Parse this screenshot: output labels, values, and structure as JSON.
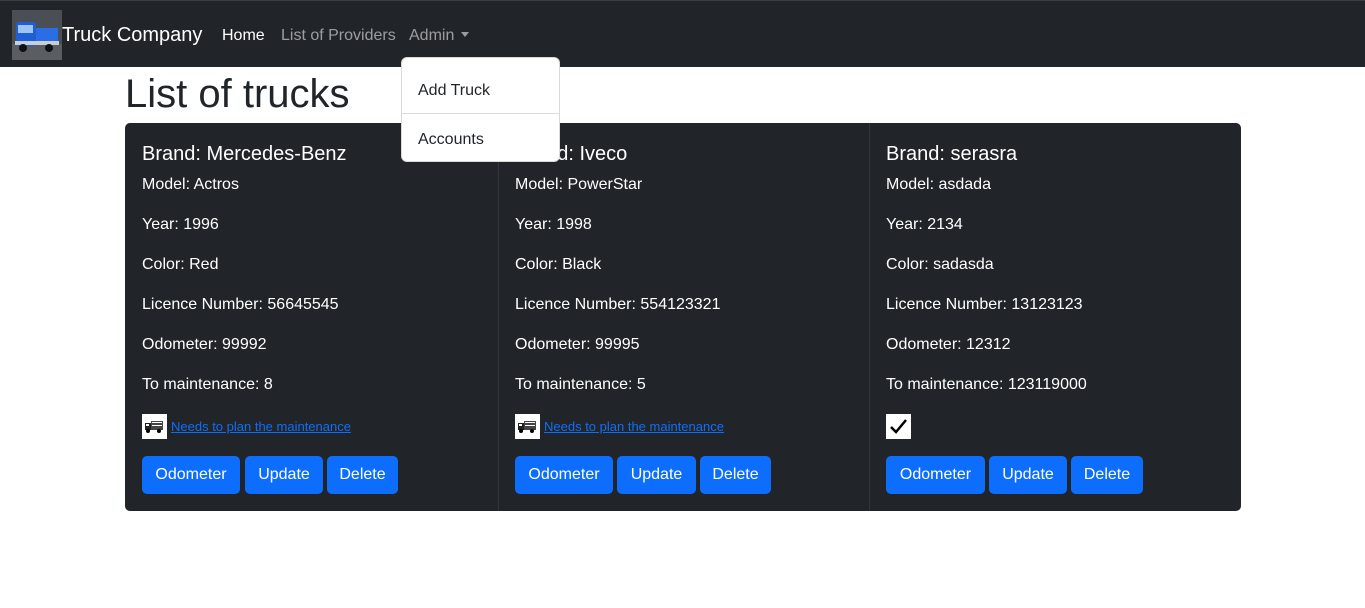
{
  "navbar": {
    "brand": "Truck Company",
    "links": [
      {
        "label": "Home",
        "active": true
      },
      {
        "label": "List of Providers",
        "active": false
      },
      {
        "label": "Admin",
        "active": false
      }
    ],
    "logo_icon": "truck-logo-image"
  },
  "dropdown": {
    "items": [
      "Add Truck",
      "Accounts"
    ]
  },
  "page": {
    "title": "List of trucks"
  },
  "labels": {
    "brand": "Brand: ",
    "model": "Model: ",
    "year": "Year: ",
    "color": "Color: ",
    "licence": "Licence Number: ",
    "odometer": "Odometer: ",
    "maintenance": "To maintenance: "
  },
  "trucks": [
    {
      "brand": "Mercedes-Benz",
      "model": "Actros",
      "year": "1996",
      "color": "Red",
      "licence": "56645545",
      "odometer": "99992",
      "maintenance": "8",
      "status": "needs-maintenance",
      "status_text": "Needs to plan the maintenance",
      "status_icon": "truck-maintenance-icon",
      "buttons": [
        "Odometer",
        "Update",
        "Delete"
      ]
    },
    {
      "brand": "Iveco",
      "model": "PowerStar",
      "year": "1998",
      "color": "Black",
      "licence": "554123321",
      "odometer": "99995",
      "maintenance": "5",
      "status": "needs-maintenance",
      "status_text": "Needs to plan the maintenance",
      "status_icon": "truck-maintenance-icon",
      "buttons": [
        "Odometer",
        "Update",
        "Delete"
      ]
    },
    {
      "brand": "serasra",
      "model": "asdada",
      "year": "2134",
      "color": "sadasda",
      "licence": "13123123",
      "odometer": "12312",
      "maintenance": "123119000",
      "status": "ok",
      "status_text": "",
      "status_icon": "checkmark-icon",
      "buttons": [
        "Odometer",
        "Update",
        "Delete"
      ]
    }
  ],
  "colors": {
    "navbar_bg": "#212529",
    "card_bg": "#212529",
    "primary": "#0d6efd",
    "link": "#0d6efd"
  }
}
